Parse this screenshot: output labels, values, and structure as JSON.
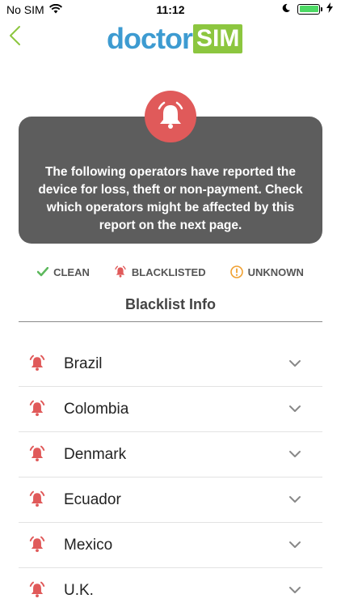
{
  "status_bar": {
    "carrier": "No SIM",
    "time": "11:12"
  },
  "header": {
    "logo_part1": "doctor",
    "logo_part2": "SIM"
  },
  "alert": {
    "message": "The following operators have reported the device for loss, theft or non-payment. Check which operators might be affected by this report on the next page."
  },
  "legend": {
    "clean": "CLEAN",
    "blacklisted": "BLACKLISTED",
    "unknown": "UNKNOWN"
  },
  "section": {
    "title": "Blacklist Info"
  },
  "countries": [
    {
      "name": "Brazil",
      "status": "blacklisted"
    },
    {
      "name": "Colombia",
      "status": "blacklisted"
    },
    {
      "name": "Denmark",
      "status": "blacklisted"
    },
    {
      "name": "Ecuador",
      "status": "blacklisted"
    },
    {
      "name": "Mexico",
      "status": "blacklisted"
    },
    {
      "name": "U.K.",
      "status": "blacklisted"
    }
  ],
  "colors": {
    "brand_blue": "#3d9bd1",
    "brand_green": "#8cc63f",
    "blacklisted_red": "#e05a5a",
    "unknown_orange": "#f0a030",
    "clean_green": "#5cb85c"
  }
}
